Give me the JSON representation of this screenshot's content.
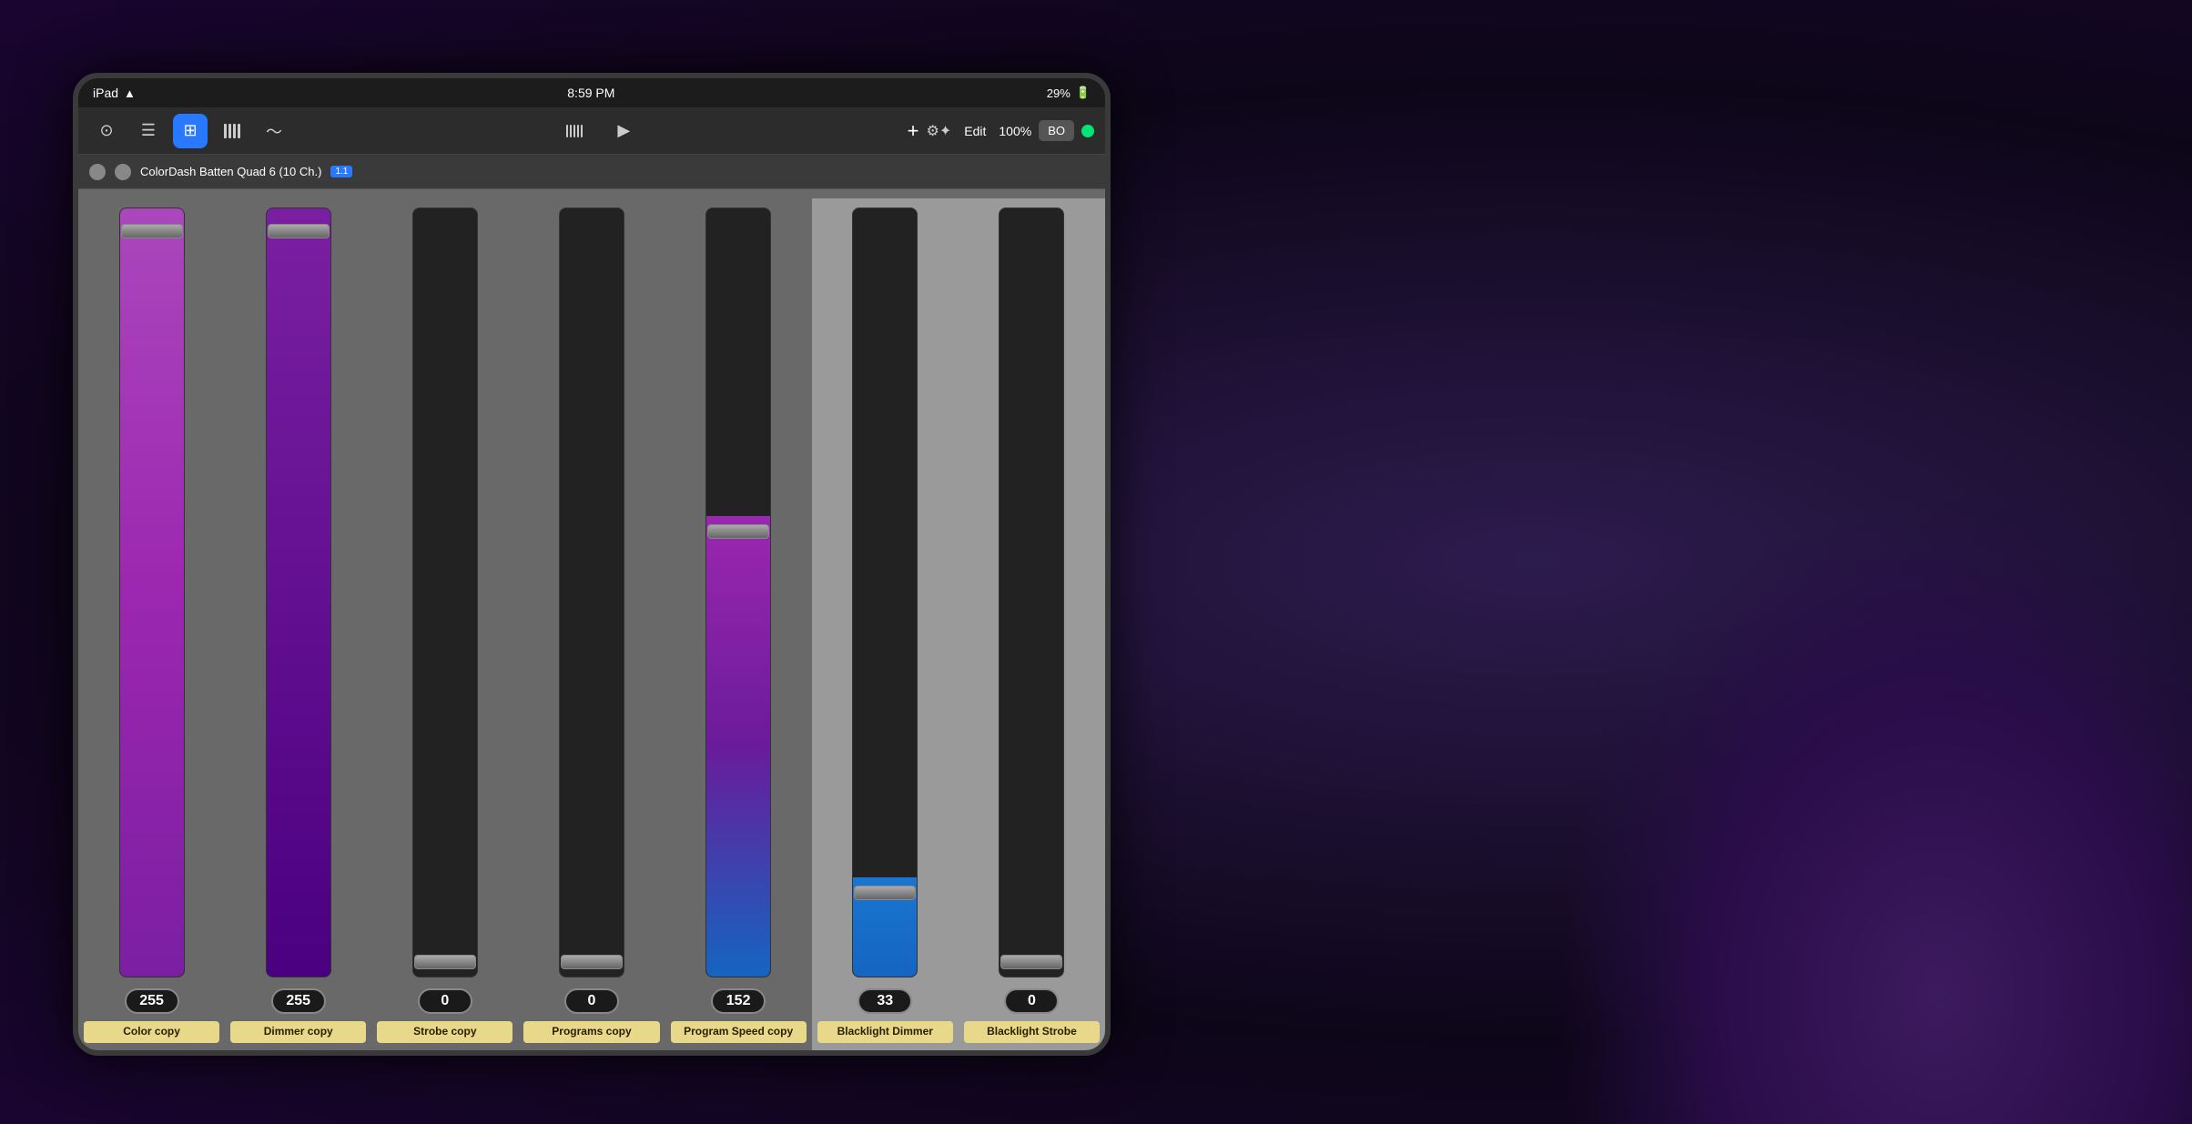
{
  "device": {
    "status_bar": {
      "carrier": "iPad",
      "wifi": "wifi",
      "time": "8:59 PM",
      "battery": "29%"
    },
    "toolbar": {
      "btn_target": "⊙",
      "btn_list": "≡",
      "btn_grid": "⊞",
      "btn_fader": "||||",
      "btn_wave": "~",
      "btn_mixer": "↑↓",
      "btn_play": "▶",
      "btn_plus": "+",
      "btn_gear": "⚙",
      "btn_edit": "Edit",
      "btn_zoom": "100%",
      "btn_bo": "BO"
    },
    "device_bar": {
      "name": "ColorDash Batten Quad 6 (10 Ch.)",
      "version": "1.1"
    },
    "faders": [
      {
        "id": "color-copy",
        "value": "255",
        "label": "Color copy",
        "fill_pct": 100,
        "fill_class": "fill-purple",
        "handle_pct": 97
      },
      {
        "id": "dimmer-copy",
        "value": "255",
        "label": "Dimmer copy",
        "fill_pct": 100,
        "fill_class": "fill-purple-dim",
        "handle_pct": 97
      },
      {
        "id": "strobe-copy",
        "value": "0",
        "label": "Strobe copy",
        "fill_pct": 0,
        "fill_class": "fill-purple",
        "handle_pct": 2
      },
      {
        "id": "programs-copy",
        "value": "0",
        "label": "Programs copy",
        "fill_pct": 0,
        "fill_class": "fill-purple",
        "handle_pct": 2
      },
      {
        "id": "program-speed-copy",
        "value": "152",
        "label": "Program Speed copy",
        "fill_pct": 60,
        "fill_class": "fill-blue-purple",
        "handle_pct": 58
      },
      {
        "id": "blacklight-dimmer",
        "value": "33",
        "label": "Blacklight Dimmer",
        "fill_pct": 13,
        "fill_class": "fill-blue",
        "handle_pct": 11
      },
      {
        "id": "blacklight-strobe",
        "value": "0",
        "label": "Blacklight Strobe",
        "fill_pct": 0,
        "fill_class": "fill-blue",
        "handle_pct": 2
      }
    ]
  }
}
